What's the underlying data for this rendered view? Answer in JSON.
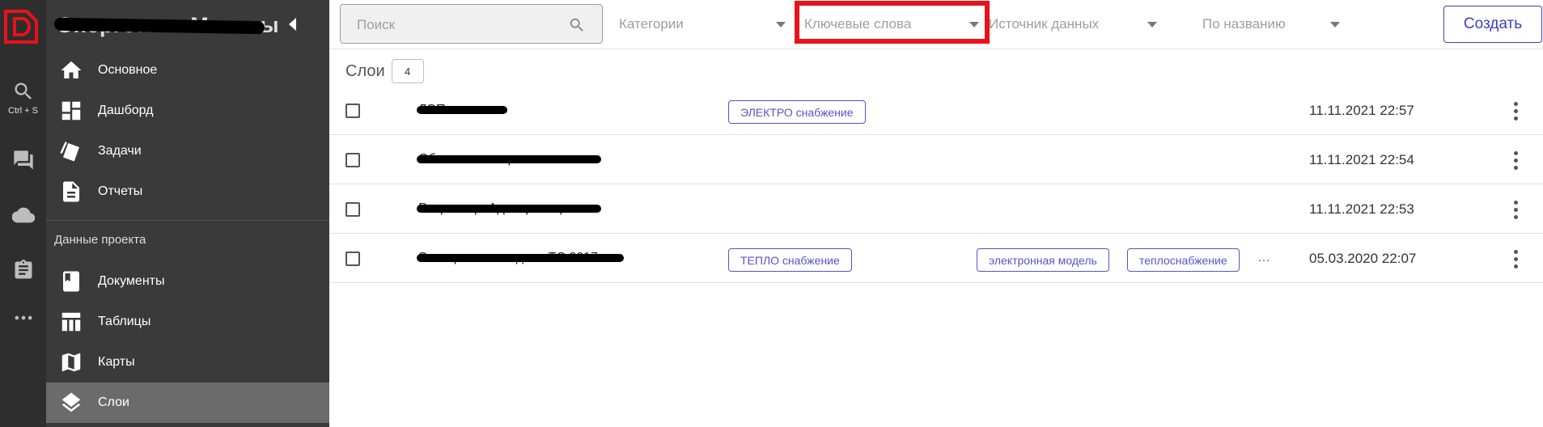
{
  "app": {
    "title": "Энергетика Москвы",
    "logo_letter": "D"
  },
  "rail": {
    "items": [
      {
        "name": "search-icon",
        "caption": "Ctrl + S"
      },
      {
        "name": "chat-icon",
        "caption": ""
      },
      {
        "name": "cloud-icon",
        "caption": ""
      },
      {
        "name": "clipboard-icon",
        "caption": ""
      },
      {
        "name": "more-icon",
        "caption": ""
      }
    ]
  },
  "sidebar": {
    "items": [
      {
        "label": "Основное",
        "icon": "home-icon"
      },
      {
        "label": "Дашборд",
        "icon": "dashboard-icon"
      },
      {
        "label": "Задачи",
        "icon": "tasks-icon"
      },
      {
        "label": "Отчеты",
        "icon": "report-icon"
      }
    ],
    "section_label": "Данные проекта",
    "project_items": [
      {
        "label": "Документы",
        "icon": "book-icon"
      },
      {
        "label": "Таблицы",
        "icon": "table-icon"
      },
      {
        "label": "Карты",
        "icon": "map-icon"
      },
      {
        "label": "Слои",
        "icon": "layers-icon",
        "active": true
      }
    ]
  },
  "filters": {
    "search_placeholder": "Поиск",
    "categories": "Категории",
    "keywords": "Ключевые слова",
    "source": "Источник данных",
    "sort": "По названию",
    "create_label": "Создать",
    "highlight_color": "#e8121b"
  },
  "layers": {
    "title": "Слои",
    "count": "4",
    "rows": [
      {
        "name": "ЛЭП линии",
        "tag": "ЭЛЕКТРО снабжение",
        "keywords": [],
        "date": "11.11.2021 22:57"
      },
      {
        "name": "Объекты капстроительства",
        "tag": "",
        "keywords": [],
        "date": "11.11.2021 22:54"
      },
      {
        "name": "Росреестр. Адм. границы",
        "tag": "",
        "keywords": [],
        "date": "11.11.2021 22:53"
      },
      {
        "name": "Электронная модель ТС 2017",
        "tag": "ТЕПЛО снабжение",
        "keywords": [
          "электронная модель",
          "теплоснабжение"
        ],
        "more": "…",
        "date": "05.03.2020 22:07"
      }
    ]
  },
  "colors": {
    "accent": "#5653d0",
    "sidebar_bg": "#3a3a3a",
    "rail_bg": "#2e2e2e",
    "active_item": "#6b6b6b"
  }
}
